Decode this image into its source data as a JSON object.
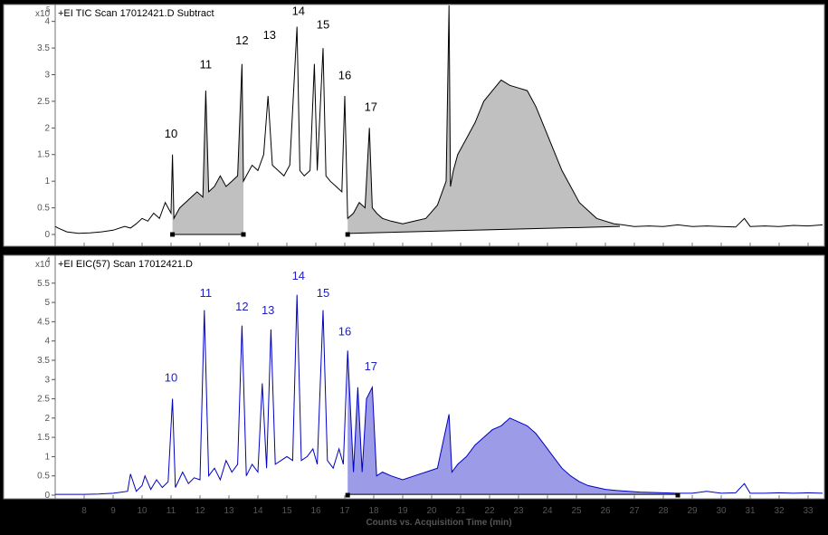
{
  "chart_data": [
    {
      "type": "line",
      "title": "+EI TIC Scan 17012421.D  Subtract",
      "y_multiplier": "x10",
      "y_exponent": "5",
      "ylim": [
        0,
        4.3
      ],
      "yticks": [
        "0",
        "0.5",
        "1",
        "1.5",
        "2",
        "2.5",
        "3",
        "3.5",
        "4"
      ],
      "line_color": "#000000",
      "fill_color": "#c0c0c0",
      "shaded_regions": [
        {
          "x": [
            11.05,
            13.5
          ],
          "baseline": [
            0.0,
            0.0
          ]
        },
        {
          "x": [
            17.1,
            26.5
          ],
          "baseline": [
            0.02,
            0.15
          ]
        }
      ],
      "baseline_markers": [
        11.05,
        13.5,
        17.1
      ],
      "peak_labels": [
        {
          "label": "10",
          "x": 11.0,
          "y": 1.75
        },
        {
          "label": "11",
          "x": 12.2,
          "y": 3.05
        },
        {
          "label": "12",
          "x": 13.45,
          "y": 3.5
        },
        {
          "label": "13",
          "x": 14.4,
          "y": 3.6
        },
        {
          "label": "14",
          "x": 15.4,
          "y": 4.05
        },
        {
          "label": "15",
          "x": 16.25,
          "y": 3.8
        },
        {
          "label": "16",
          "x": 17.0,
          "y": 2.85
        },
        {
          "label": "17",
          "x": 17.9,
          "y": 2.25
        }
      ],
      "series": [
        {
          "name": "TIC",
          "x": [
            7.0,
            7.1,
            7.4,
            7.8,
            8.2,
            8.6,
            9.0,
            9.4,
            9.6,
            9.8,
            10.0,
            10.2,
            10.4,
            10.6,
            10.8,
            11.0,
            11.05,
            11.1,
            11.3,
            11.5,
            11.7,
            11.9,
            12.1,
            12.2,
            12.3,
            12.5,
            12.7,
            12.9,
            13.1,
            13.3,
            13.45,
            13.5,
            13.6,
            13.8,
            14.0,
            14.2,
            14.35,
            14.5,
            14.7,
            14.9,
            15.1,
            15.35,
            15.45,
            15.6,
            15.8,
            15.95,
            16.05,
            16.25,
            16.35,
            16.5,
            16.7,
            16.9,
            17.0,
            17.1,
            17.3,
            17.5,
            17.7,
            17.85,
            17.95,
            18.1,
            18.3,
            18.6,
            19.0,
            19.4,
            19.8,
            20.2,
            20.5,
            20.6,
            20.65,
            20.75,
            20.9,
            21.2,
            21.5,
            21.8,
            22.1,
            22.4,
            22.7,
            23.0,
            23.3,
            23.6,
            23.9,
            24.2,
            24.5,
            24.8,
            25.1,
            25.4,
            25.7,
            26.0,
            26.3,
            26.6,
            27.0,
            27.5,
            28.0,
            28.5,
            29.0,
            29.5,
            30.0,
            30.5,
            30.8,
            31.0,
            31.5,
            32.0,
            32.5,
            33.0,
            33.5
          ],
          "values": [
            0.15,
            0.12,
            0.05,
            0.02,
            0.03,
            0.05,
            0.08,
            0.15,
            0.12,
            0.2,
            0.3,
            0.25,
            0.4,
            0.3,
            0.6,
            0.4,
            1.5,
            0.3,
            0.5,
            0.6,
            0.7,
            0.8,
            0.7,
            2.7,
            0.8,
            0.9,
            1.1,
            0.9,
            1.0,
            1.1,
            3.2,
            1.0,
            1.1,
            1.3,
            1.2,
            1.5,
            2.6,
            1.3,
            1.2,
            1.1,
            1.3,
            3.9,
            1.2,
            1.1,
            1.2,
            3.2,
            1.2,
            3.5,
            1.1,
            1.0,
            0.9,
            0.8,
            2.6,
            0.3,
            0.4,
            0.6,
            0.5,
            2.0,
            0.5,
            0.4,
            0.3,
            0.25,
            0.2,
            0.25,
            0.3,
            0.55,
            1.0,
            4.3,
            0.9,
            1.2,
            1.5,
            1.8,
            2.1,
            2.5,
            2.7,
            2.9,
            2.8,
            2.75,
            2.7,
            2.4,
            2.0,
            1.6,
            1.2,
            0.9,
            0.6,
            0.45,
            0.3,
            0.25,
            0.2,
            0.18,
            0.15,
            0.16,
            0.15,
            0.18,
            0.15,
            0.16,
            0.15,
            0.14,
            0.3,
            0.15,
            0.16,
            0.15,
            0.17,
            0.16,
            0.18
          ]
        }
      ]
    },
    {
      "type": "line",
      "title": "+EI EIC(57) Scan 17012421.D",
      "y_multiplier": "x10",
      "y_exponent": "4",
      "ylim": [
        0,
        6.2
      ],
      "yticks": [
        "0",
        "0.5",
        "1",
        "1.5",
        "2",
        "2.5",
        "3",
        "3.5",
        "4",
        "4.5",
        "5",
        "5.5"
      ],
      "xlabel": "Counts vs. Acquisition Time (min)",
      "xticks": [
        8,
        9,
        10,
        11,
        12,
        13,
        14,
        15,
        16,
        17,
        18,
        19,
        20,
        21,
        22,
        23,
        24,
        25,
        26,
        27,
        28,
        29,
        30,
        31,
        32,
        33
      ],
      "xlim": [
        7.0,
        33.5
      ],
      "line_color": "#0000c0",
      "fill_color": "#9b9be8",
      "shaded_regions": [
        {
          "x": [
            17.1,
            28.5
          ],
          "baseline": [
            0.02,
            0.02
          ]
        }
      ],
      "baseline_markers": [
        17.1,
        28.5
      ],
      "peak_labels": [
        {
          "label": "10",
          "x": 11.0,
          "y": 2.85
        },
        {
          "label": "11",
          "x": 12.2,
          "y": 5.05
        },
        {
          "label": "12",
          "x": 13.45,
          "y": 4.7
        },
        {
          "label": "13",
          "x": 14.35,
          "y": 4.6
        },
        {
          "label": "14",
          "x": 15.4,
          "y": 5.5
        },
        {
          "label": "15",
          "x": 16.25,
          "y": 5.05
        },
        {
          "label": "16",
          "x": 17.0,
          "y": 4.05
        },
        {
          "label": "17",
          "x": 17.9,
          "y": 3.15
        }
      ],
      "series": [
        {
          "name": "EIC(57)",
          "x": [
            7.0,
            7.5,
            8.0,
            8.5,
            9.0,
            9.5,
            9.6,
            9.8,
            10.0,
            10.1,
            10.3,
            10.5,
            10.7,
            10.9,
            11.05,
            11.15,
            11.4,
            11.6,
            11.8,
            12.0,
            12.15,
            12.3,
            12.5,
            12.7,
            12.9,
            13.1,
            13.3,
            13.45,
            13.6,
            13.8,
            14.0,
            14.15,
            14.3,
            14.45,
            14.6,
            14.8,
            15.0,
            15.2,
            15.35,
            15.5,
            15.7,
            15.9,
            16.05,
            16.25,
            16.4,
            16.6,
            16.8,
            16.95,
            17.1,
            17.3,
            17.45,
            17.6,
            17.75,
            17.95,
            18.1,
            18.3,
            18.6,
            19.0,
            19.4,
            19.8,
            20.2,
            20.6,
            20.7,
            20.9,
            21.2,
            21.5,
            21.8,
            22.1,
            22.4,
            22.7,
            23.0,
            23.3,
            23.6,
            23.9,
            24.2,
            24.5,
            24.8,
            25.1,
            25.4,
            25.7,
            26.0,
            26.4,
            26.8,
            27.2,
            27.6,
            28.0,
            28.5,
            29.0,
            29.5,
            30.0,
            30.5,
            30.8,
            31.0,
            31.5,
            32.0,
            32.5,
            33.0,
            33.5
          ],
          "values": [
            0.02,
            0.02,
            0.02,
            0.03,
            0.05,
            0.1,
            0.55,
            0.1,
            0.25,
            0.5,
            0.15,
            0.4,
            0.2,
            0.35,
            2.5,
            0.2,
            0.6,
            0.3,
            0.45,
            0.4,
            4.8,
            0.5,
            0.7,
            0.4,
            0.9,
            0.6,
            0.8,
            4.4,
            0.5,
            0.8,
            0.6,
            2.9,
            0.7,
            4.3,
            0.8,
            0.9,
            1.0,
            0.9,
            5.2,
            0.9,
            1.0,
            1.2,
            0.8,
            4.8,
            0.9,
            0.7,
            1.2,
            0.8,
            3.75,
            0.6,
            2.8,
            0.6,
            2.5,
            2.8,
            0.5,
            0.6,
            0.5,
            0.4,
            0.5,
            0.6,
            0.7,
            2.1,
            0.6,
            0.8,
            1.0,
            1.3,
            1.5,
            1.7,
            1.8,
            2.0,
            1.9,
            1.8,
            1.6,
            1.3,
            1.0,
            0.7,
            0.5,
            0.35,
            0.25,
            0.2,
            0.15,
            0.12,
            0.1,
            0.08,
            0.07,
            0.06,
            0.05,
            0.05,
            0.1,
            0.05,
            0.06,
            0.3,
            0.05,
            0.05,
            0.06,
            0.05,
            0.06,
            0.05
          ]
        }
      ]
    }
  ]
}
